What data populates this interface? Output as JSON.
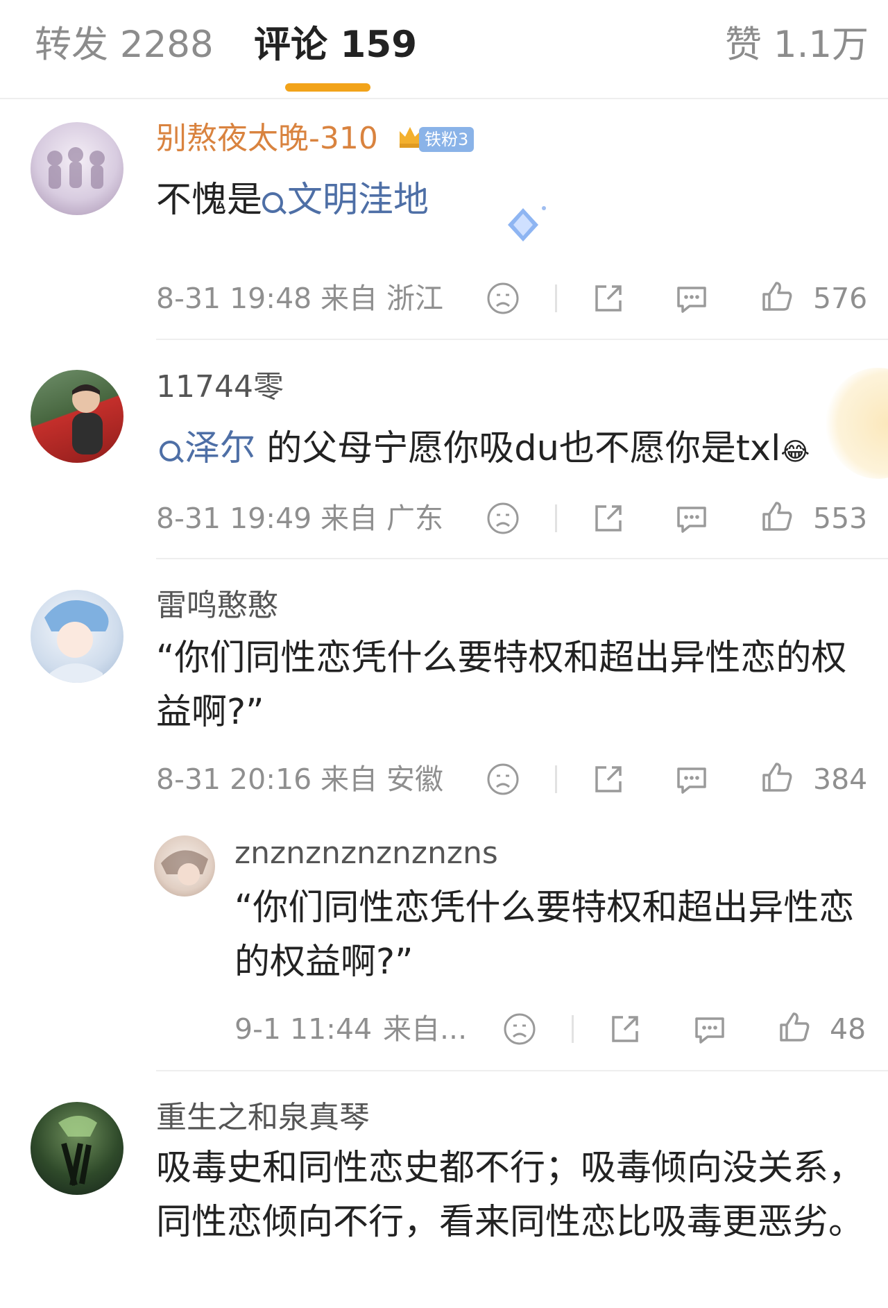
{
  "tabs": {
    "repost": "转发 2288",
    "comments": "评论 159",
    "likes": "赞 1.1万"
  },
  "comments": [
    {
      "username": "别熬夜太晚-310",
      "badge": "铁粉3",
      "text": "不愧是",
      "topic": "文明洼地",
      "time": "8-31 19:48",
      "location": "来自 浙江",
      "likes": "576"
    },
    {
      "username": "11744零",
      "topic": "泽尔",
      "text": " 的父母宁愿你吸du也不愿你是txl",
      "emoji": "😂",
      "time": "8-31 19:49",
      "location": "来自 广东",
      "likes": "553"
    },
    {
      "username": "雷鸣憨憨",
      "text": "“你们同性恋凭什么要特权和超出异性恋的权益啊?”",
      "time": "8-31 20:16",
      "location": "来自 安徽",
      "likes": "384"
    },
    {
      "username": "znznznznznznzns",
      "text": "“你们同性恋凭什么要特权和超出异性恋的权益啊?”",
      "time": "9-1 11:44",
      "location": "来自...",
      "likes": "48"
    },
    {
      "username": "重生之和泉真琴",
      "text": "吸毒史和同性恋史都不行；吸毒倾向没关系，同性恋倾向不行，看来同性恋比吸毒更恶劣。"
    }
  ]
}
